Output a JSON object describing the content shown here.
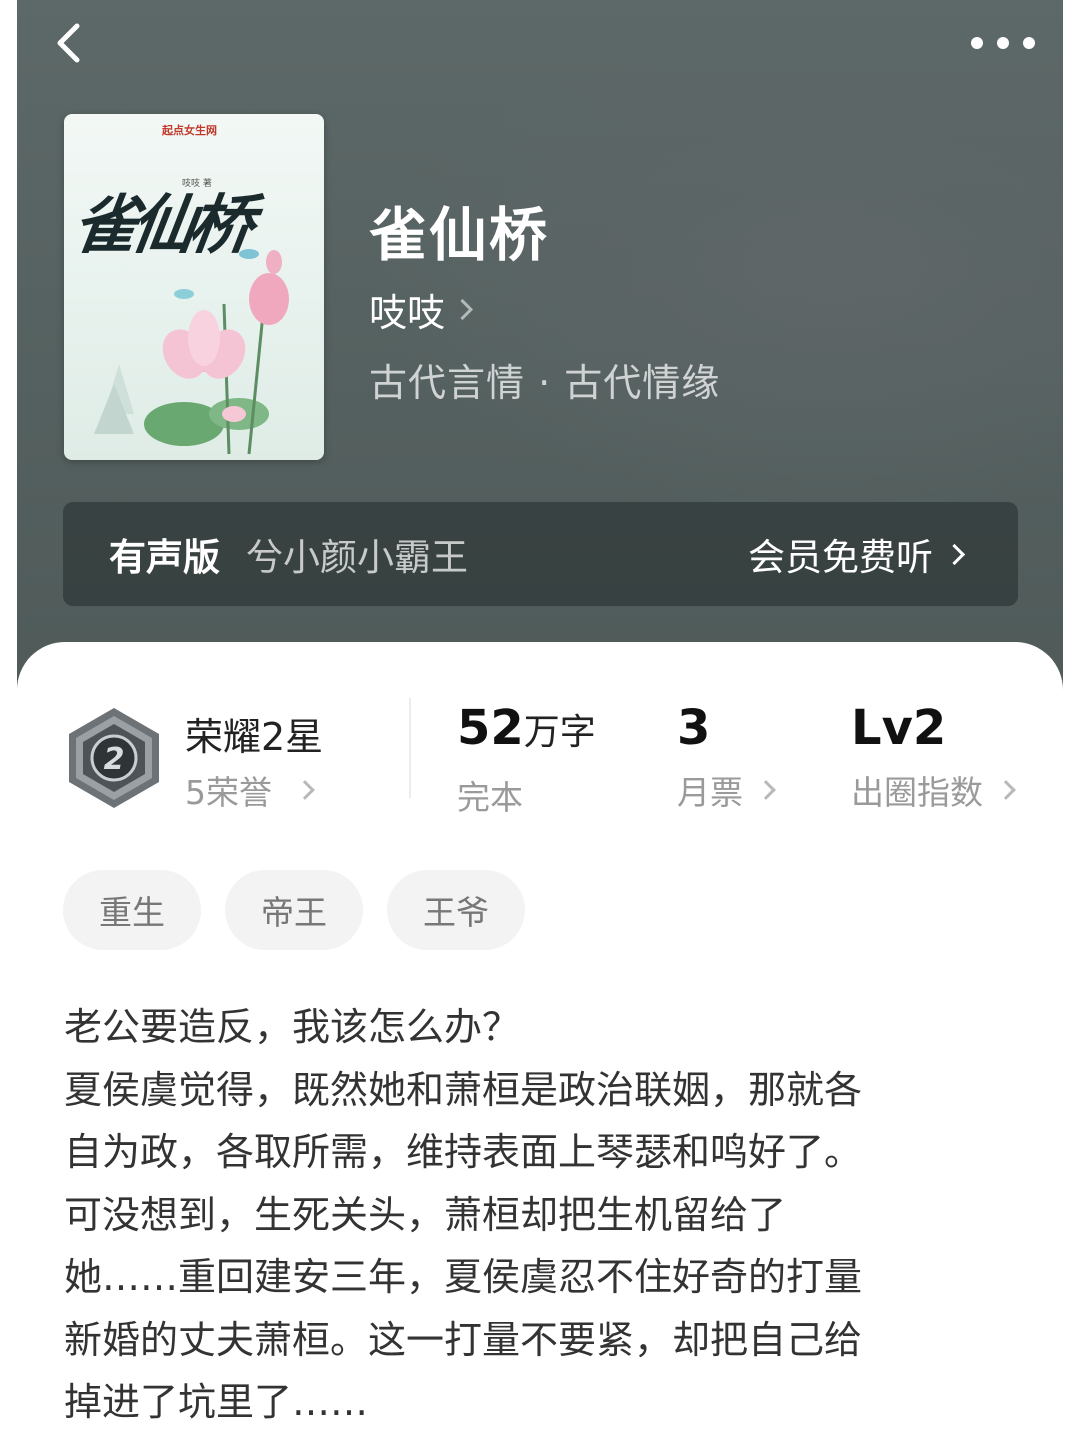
{
  "header": {
    "back_icon": "chevron-left-icon",
    "more_icon": "more-horizontal-icon"
  },
  "book": {
    "cover": {
      "publisher_logo": "起点女生网",
      "author_mark": "吱吱 著",
      "title_calligraphy": "雀仙桥"
    },
    "title": "雀仙桥",
    "author": "吱吱",
    "genre": "古代言情 · 古代情缘"
  },
  "audio": {
    "label": "有声版",
    "narrator": "兮小颜小霸王",
    "cta": "会员免费听"
  },
  "stats": {
    "honor": {
      "title": "荣耀2星",
      "sub": "5荣誉",
      "badge_number": "2"
    },
    "words": {
      "value": "52",
      "unit": "万字",
      "label": "完本"
    },
    "monthly_votes": {
      "value": "3",
      "label": "月票"
    },
    "popularity": {
      "value": "Lv2",
      "label": "出圈指数"
    }
  },
  "tags": [
    "重生",
    "帝王",
    "王爷"
  ],
  "description": "老公要造反，我该怎么办？\n夏侯虞觉得，既然她和萧桓是政治联姻，那就各\n自为政，各取所需，维持表面上琴瑟和鸣好了。\n可没想到，生死关头，萧桓却把生机留给了\n她……重回建安三年，夏侯虞忍不住好奇的打量\n新婚的丈夫萧桓。这一打量不要紧，却把自己给\n掉进了坑里了……",
  "colors": {
    "hero_bg": "#566261",
    "sheet_bg": "#ffffff",
    "tag_bg": "#f3f3f3",
    "muted_text": "#9a9a9a"
  }
}
